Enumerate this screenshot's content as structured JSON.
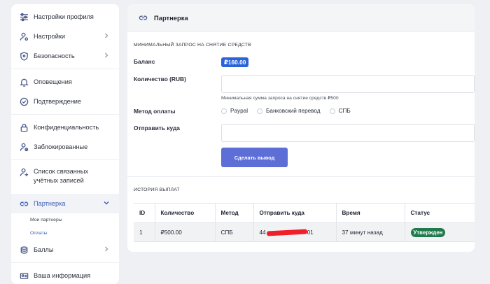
{
  "sidebar": {
    "items": [
      {
        "label": "Настройки профиля",
        "icon": "sliders-icon"
      },
      {
        "label": "Настройки",
        "icon": "user-gear-icon"
      },
      {
        "label": "Безопасность",
        "icon": "shield-icon"
      },
      {
        "label": "Оповещения",
        "icon": "bell-icon"
      },
      {
        "label": "Подтверждение",
        "icon": "check-circle-icon"
      },
      {
        "label": "Конфиденциальность",
        "icon": "lock-icon"
      },
      {
        "label": "Заблокированные",
        "icon": "user-block-icon"
      },
      {
        "label": "Список связанных учётных записей",
        "icon": "user-link-icon"
      },
      {
        "label": "Партнерка",
        "icon": "link-icon"
      },
      {
        "label": "Баллы",
        "icon": "coins-icon"
      },
      {
        "label": "Ваша информация",
        "icon": "id-card-icon"
      }
    ],
    "subitems": [
      {
        "label": "Мои партнеры"
      },
      {
        "label": "Оплаты"
      }
    ]
  },
  "panel": {
    "title": "Партнерка",
    "withdraw_section": "Минимальный запрос на снятие средств",
    "balance_label": "Баланс",
    "balance_value": "₽160.00",
    "amount_label": "Количество (RUB)",
    "amount_value": "",
    "amount_hint": "Минимальная сумма запроса на снятие средств ₽500",
    "method_label": "Метод оплаты",
    "methods": [
      "Paypal",
      "Банковский перевод",
      "СПБ"
    ],
    "destination_label": "Отправить куда",
    "destination_value": "",
    "submit_label": "Сделать вывод",
    "history_title": "История выплат"
  },
  "history": {
    "columns": [
      "ID",
      "Количество",
      "Метод",
      "Отправить куда",
      "Время",
      "Статус"
    ],
    "rows": [
      {
        "id": "1",
        "amount": "₽500.00",
        "method": "СПБ",
        "dest_prefix": "44",
        "dest_suffix": "01",
        "time": "37 минут назад",
        "status": "Утвержден"
      }
    ]
  },
  "colors": {
    "accent": "#2b63d8",
    "button": "#5d6fd6",
    "status_approved": "#207a4c",
    "active_nav": "#3c5db8"
  }
}
